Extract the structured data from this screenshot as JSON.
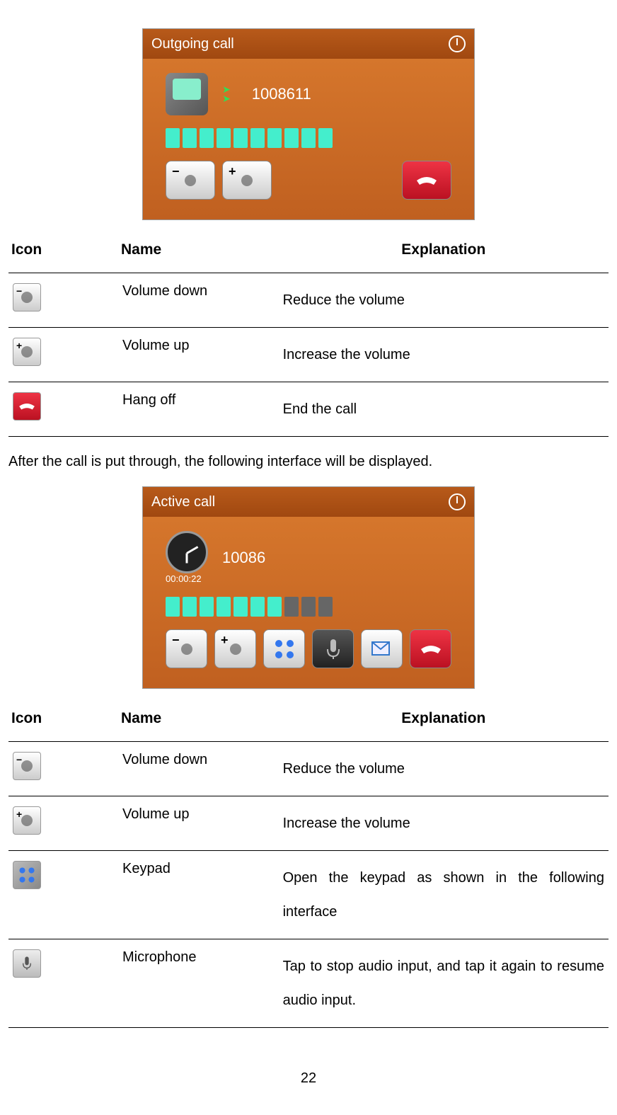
{
  "screenshot1": {
    "title": "Outgoing call",
    "number": "1008611",
    "progress_total": 10,
    "progress_filled": 10
  },
  "table1": {
    "headers": {
      "icon": "Icon",
      "name": "Name",
      "explanation": "Explanation"
    },
    "rows": [
      {
        "name": "Volume down",
        "explanation": "Reduce the volume"
      },
      {
        "name": "Volume up",
        "explanation": "Increase the volume"
      },
      {
        "name": "Hang off",
        "explanation": "End the call"
      }
    ]
  },
  "transition_text": "After the call is put through, the following interface will be displayed.",
  "screenshot2": {
    "title": "Active call",
    "number": "10086",
    "timer": "00:00:22",
    "progress_total": 10,
    "progress_filled": 7
  },
  "table2": {
    "headers": {
      "icon": "Icon",
      "name": "Name",
      "explanation": "Explanation"
    },
    "rows": [
      {
        "name": "Volume down",
        "explanation": "Reduce the volume"
      },
      {
        "name": "Volume up",
        "explanation": "Increase the volume"
      },
      {
        "name": "Keypad",
        "explanation": "Open the keypad as shown in the following interface"
      },
      {
        "name": "Microphone",
        "explanation": "Tap to stop audio input, and tap it again to resume audio input."
      }
    ]
  },
  "page_number": "22"
}
